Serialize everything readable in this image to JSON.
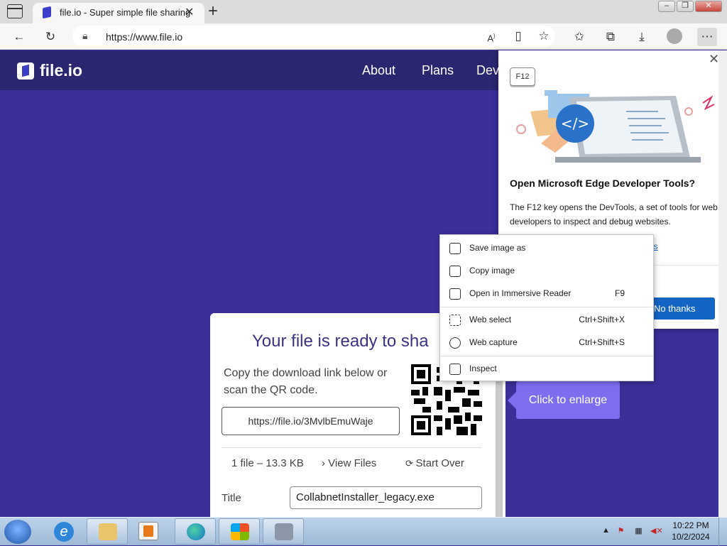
{
  "browser": {
    "tab_title": "file.io - Super simple file sharing",
    "tab_close": "✕",
    "new_tab": "+",
    "url": "https://www.file.io",
    "window_controls": {
      "minimize": "–",
      "maximize": "❐",
      "close": "✕"
    },
    "toolbar_icons": [
      "back-icon",
      "refresh-icon",
      "lock-icon",
      "read-aloud-icon",
      "immersive-reader-icon",
      "add-favorite-icon",
      "favorites-icon",
      "collections-icon",
      "downloads-icon",
      "profile-icon",
      "more-icon"
    ]
  },
  "site": {
    "logo": "file.io",
    "nav": [
      "About",
      "Plans",
      "Dev"
    ]
  },
  "card": {
    "title": "Your file is ready to sha",
    "description": "Copy the download link below or scan the QR code.",
    "link": "https://file.io/3MvlbEmuWaje",
    "file_info": "1 file – 13.3 KB",
    "view_files": "View Files",
    "start_over": "Start Over",
    "title_label": "Title",
    "title_value": "CollabnetInstaller_legacy.exe"
  },
  "enlarge_tooltip": "Click to enlarge",
  "devtools_popup": {
    "badge": "F12",
    "close": "✕",
    "title": "Open Microsoft Edge Developer Tools?",
    "body": "The F12 key opens the DevTools, a set of tools for web developers to inspect and debug websites.",
    "link_fragment": "gs",
    "no_thanks": "No thanks"
  },
  "context_menu": {
    "groups": [
      [
        {
          "label": "Save image as",
          "shortcut": "",
          "icon": "save-image-icon"
        },
        {
          "label": "Copy image",
          "shortcut": "",
          "icon": "copy-image-icon"
        },
        {
          "label": "Open in Immersive Reader",
          "shortcut": "F9",
          "icon": "immersive-reader-icon"
        }
      ],
      [
        {
          "label": "Web select",
          "shortcut": "Ctrl+Shift+X",
          "icon": "web-select-icon"
        },
        {
          "label": "Web capture",
          "shortcut": "Ctrl+Shift+S",
          "icon": "web-capture-icon"
        }
      ],
      [
        {
          "label": "Inspect",
          "shortcut": "",
          "icon": "inspect-icon"
        }
      ]
    ]
  },
  "taskbar": {
    "time": "10:22 PM",
    "date": "10/2/2024",
    "pinned": [
      "internet-explorer-icon",
      "file-explorer-icon",
      "media-player-icon",
      "edge-icon",
      "windows-flag-icon",
      "network-app-icon"
    ]
  },
  "colors": {
    "page_bg": "#3b2f9a",
    "nav_bg": "#2b2670",
    "accent_button": "#1464c3",
    "tooltip_bg": "#7d6ef0"
  }
}
